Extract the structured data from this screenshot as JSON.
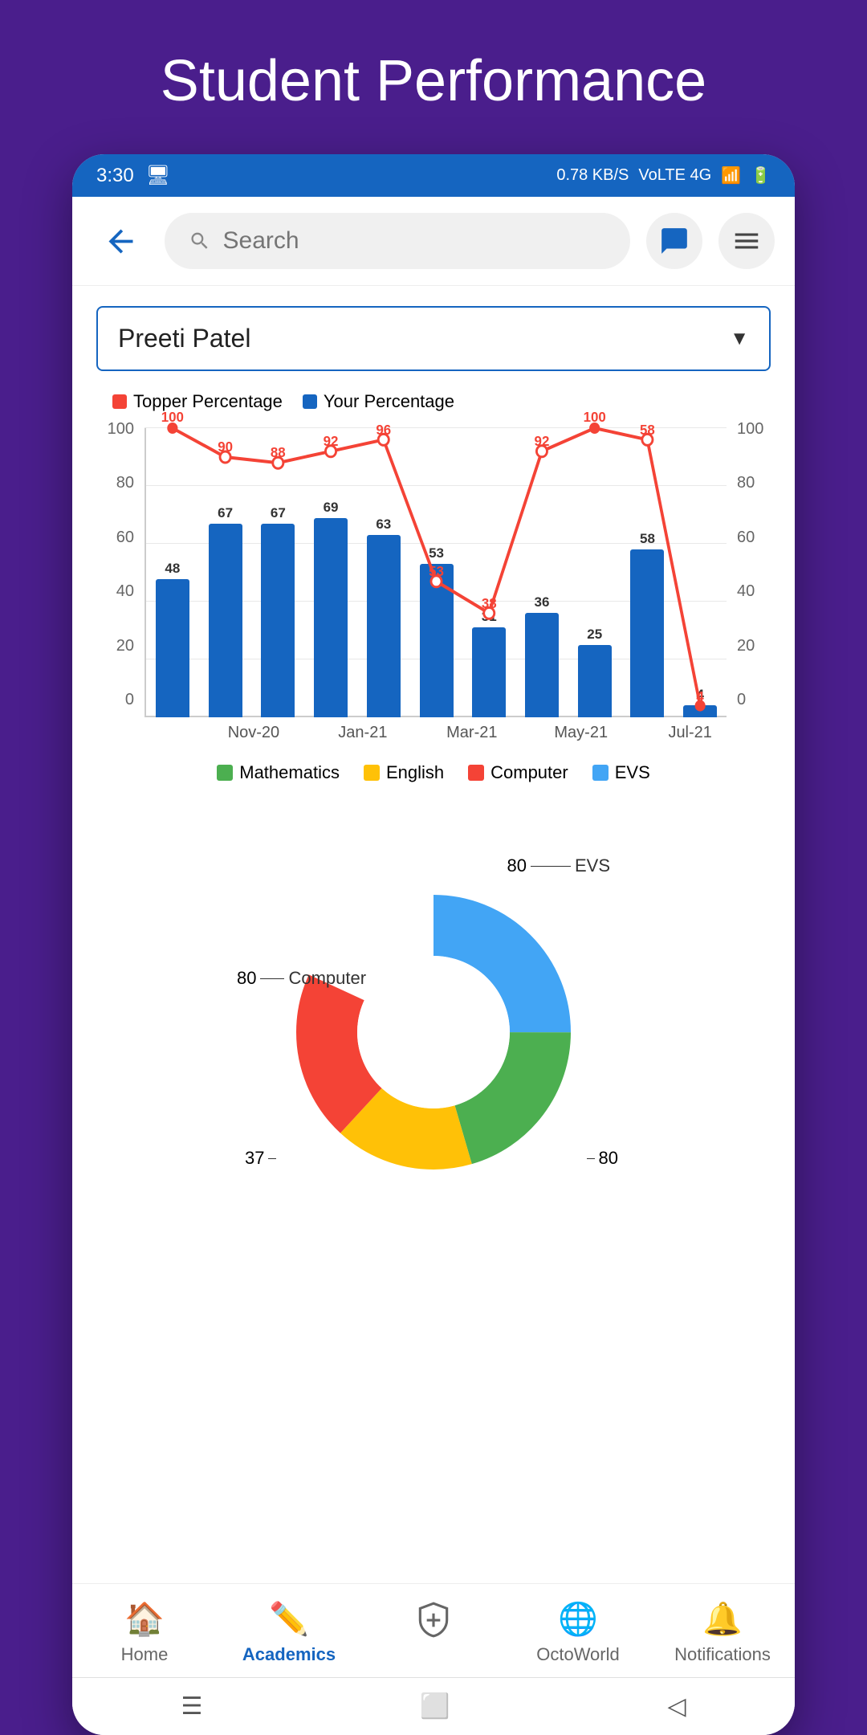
{
  "page": {
    "title": "Student Performance",
    "background_color": "#4a1e8c"
  },
  "status_bar": {
    "time": "3:30",
    "network_speed": "0.78 KB/S",
    "network_type": "VoLTE 4G",
    "battery": "6"
  },
  "top_bar": {
    "search_placeholder": "Search",
    "back_label": "Back",
    "chat_label": "Chat",
    "menu_label": "Menu"
  },
  "student_selector": {
    "selected_student": "Preeti Patel"
  },
  "chart": {
    "legend": {
      "topper": "Topper Percentage",
      "yours": "Your Percentage"
    },
    "bars": [
      {
        "month": "Nov-20",
        "value": 48,
        "topper": 100
      },
      {
        "month": "Jan-21",
        "value": 67,
        "topper": 90
      },
      {
        "month": "",
        "value": 67,
        "topper": 88
      },
      {
        "month": "Mar-21",
        "value": 69,
        "topper": 92
      },
      {
        "month": "",
        "value": 63,
        "topper": 96
      },
      {
        "month": "May-21",
        "value": 53,
        "topper": 53
      },
      {
        "month": "",
        "value": 31,
        "topper": 38
      },
      {
        "month": "Jul-21",
        "value": 36,
        "topper": 92
      },
      {
        "month": "",
        "value": 25,
        "topper": 100
      },
      {
        "month": "",
        "value": 58,
        "topper": 58
      },
      {
        "month": "",
        "value": 4,
        "topper": 4
      }
    ],
    "y_axis": [
      0,
      20,
      40,
      60,
      80,
      100
    ],
    "x_labels": [
      "Nov-20",
      "Jan-21",
      "Mar-21",
      "May-21",
      "Jul-21"
    ],
    "subjects": [
      {
        "name": "Mathematics",
        "color": "#4caf50"
      },
      {
        "name": "English",
        "color": "#ffc107"
      },
      {
        "name": "Computer",
        "color": "#f44336"
      },
      {
        "name": "EVS",
        "color": "#42a5f5"
      }
    ]
  },
  "donut_chart": {
    "segments": [
      {
        "name": "EVS",
        "value": 80,
        "color": "#42a5f5",
        "percentage": 30
      },
      {
        "name": "Mathematics",
        "value": 80,
        "color": "#4caf50",
        "percentage": 25
      },
      {
        "name": "English",
        "value": 37,
        "color": "#ffc107",
        "percentage": 20
      },
      {
        "name": "Computer",
        "value": 80,
        "color": "#f44336",
        "percentage": 25
      }
    ],
    "labels": [
      {
        "subject": "EVS",
        "value": "80",
        "position": "top-right"
      },
      {
        "subject": "Computer",
        "value": "80",
        "position": "left"
      },
      {
        "subject": "English",
        "value": "37",
        "position": "bottom-left"
      },
      {
        "subject": "Mathematics",
        "value": "80",
        "position": "bottom-right"
      }
    ]
  },
  "bottom_nav": {
    "items": [
      {
        "label": "Home",
        "icon": "🏠",
        "active": false
      },
      {
        "label": "Academics",
        "icon": "✏️",
        "active": true
      },
      {
        "label": "",
        "icon": "🛡️",
        "active": false
      },
      {
        "label": "OctoWorld",
        "icon": "🌐",
        "active": false
      },
      {
        "label": "Notifications",
        "icon": "🔔",
        "active": false
      }
    ]
  }
}
